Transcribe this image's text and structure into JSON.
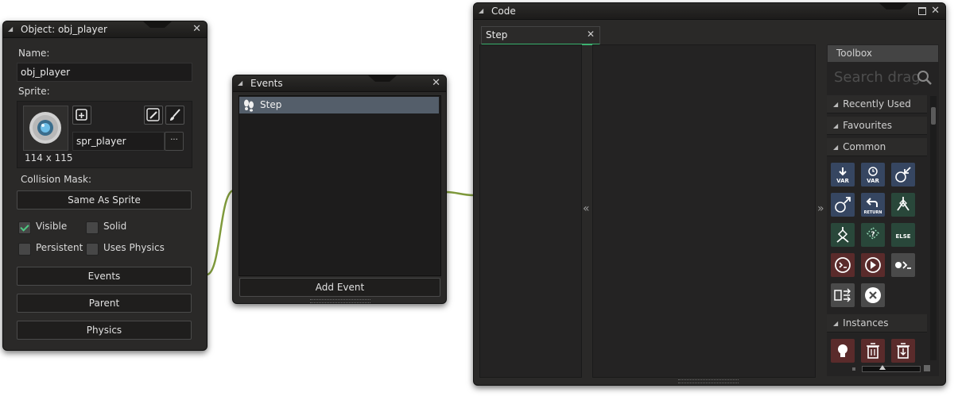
{
  "object_window": {
    "title": "Object: obj_player",
    "name_label": "Name:",
    "name_value": "obj_player",
    "sprite_label": "Sprite:",
    "sprite_name": "spr_player",
    "sprite_dims": "114 x 115",
    "browse_label": "···",
    "collision_label": "Collision Mask:",
    "collision_value": "Same As Sprite",
    "checkboxes": [
      {
        "label": "Visible",
        "checked": true
      },
      {
        "label": "Solid",
        "checked": false
      },
      {
        "label": "Persistent",
        "checked": false
      },
      {
        "label": "Uses Physics",
        "checked": false
      }
    ],
    "buttons": [
      "Events",
      "Parent",
      "Physics"
    ]
  },
  "events_window": {
    "title": "Events",
    "items": [
      "Step"
    ],
    "add_button": "Add Event"
  },
  "code_window": {
    "title": "Code",
    "tab": "Step",
    "collapse_left": "«",
    "collapse_right": "»"
  },
  "toolbox": {
    "title": "Toolbox",
    "search_placeholder": "Search drag",
    "sections": [
      "Recently Used",
      "Favourites",
      "Common",
      "Instances"
    ],
    "common_tiles": [
      {
        "icon": "declare-var-icon",
        "text": "VAR",
        "color": "#364661"
      },
      {
        "icon": "declare-temp-var-icon",
        "text": "VAR",
        "color": "#364661"
      },
      {
        "icon": "get-global-icon",
        "text": "",
        "color": "#364661"
      },
      {
        "icon": "set-global-icon",
        "text": "",
        "color": "#364661"
      },
      {
        "icon": "return-icon",
        "text": "RETURN",
        "color": "#364661"
      },
      {
        "icon": "if-branch-icon",
        "text": "",
        "color": "#29473a"
      },
      {
        "icon": "if-variable-icon",
        "text": "",
        "color": "#29473a"
      },
      {
        "icon": "if-expression-icon",
        "text": "",
        "color": "#29473a"
      },
      {
        "icon": "else-icon",
        "text": "ELSE",
        "color": "#29473a"
      },
      {
        "icon": "execute-script-icon",
        "text": "",
        "color": "#5a2b2b"
      },
      {
        "icon": "function-call-icon",
        "text": "",
        "color": "#5a2b2b"
      },
      {
        "icon": "execute-code-icon",
        "text": "",
        "color": "#4a4a4a"
      },
      {
        "icon": "swap-icon",
        "text": "",
        "color": "#4a4a4a"
      },
      {
        "icon": "exit-event-icon",
        "text": "",
        "color": "#4a4a4a"
      }
    ],
    "instance_tiles": [
      {
        "icon": "instance-create-icon",
        "color": "#5a2b2b"
      },
      {
        "icon": "instance-destroy-icon",
        "color": "#5a2b2b"
      },
      {
        "icon": "instance-change-icon",
        "color": "#5a2b2b"
      }
    ]
  }
}
